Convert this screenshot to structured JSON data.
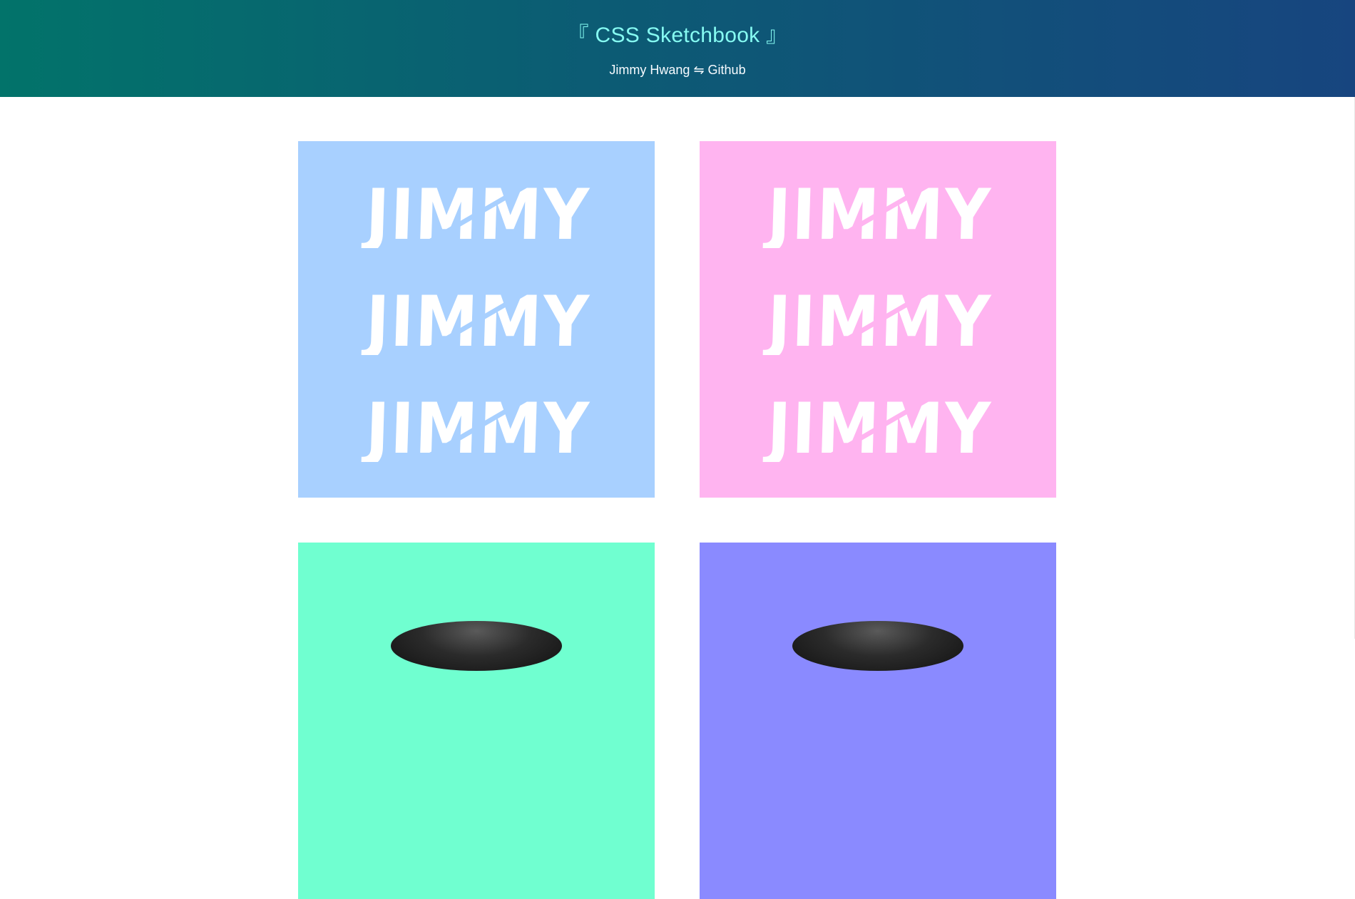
{
  "header": {
    "title": "CSS Sketchbook",
    "open_bracket": "『",
    "close_bracket": "』",
    "author": "Jimmy Hwang",
    "separator": "⇋",
    "link": "Github"
  },
  "tiles": [
    {
      "word": "JIMMY",
      "color": "#a8d0ff"
    },
    {
      "word": "JIMMY",
      "color": "#ffb4f0"
    },
    {
      "color": "#70ffd0"
    },
    {
      "color": "#8a8aff"
    }
  ]
}
